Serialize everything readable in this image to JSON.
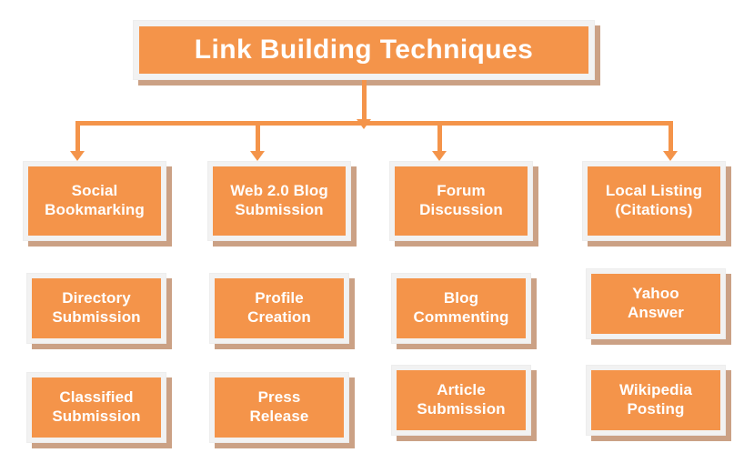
{
  "diagram": {
    "title": "Link Building Techniques",
    "colors": {
      "node_fill": "#f4944a",
      "node_frame": "#f2f2f2",
      "node_shadow": "#cba185",
      "connector": "#f4944a",
      "label_text": "#ffffff",
      "background": "#ffffff"
    },
    "rows": [
      {
        "row_name": "primary-techniques",
        "nodes": [
          {
            "label": "Social\nBookmarking"
          },
          {
            "label": "Web 2.0 Blog\nSubmission"
          },
          {
            "label": "Forum\nDiscussion"
          },
          {
            "label": "Local Listing\n(Citations)"
          }
        ]
      },
      {
        "row_name": "secondary-techniques",
        "nodes": [
          {
            "label": "Directory\nSubmission"
          },
          {
            "label": "Profile\nCreation"
          },
          {
            "label": "Blog\nCommenting"
          },
          {
            "label": "Yahoo\nAnswer"
          }
        ]
      },
      {
        "row_name": "tertiary-techniques",
        "nodes": [
          {
            "label": "Classified\nSubmission"
          },
          {
            "label": "Press\nRelease"
          },
          {
            "label": "Article\nSubmission"
          },
          {
            "label": "Wikipedia\nPosting"
          }
        ]
      }
    ]
  }
}
